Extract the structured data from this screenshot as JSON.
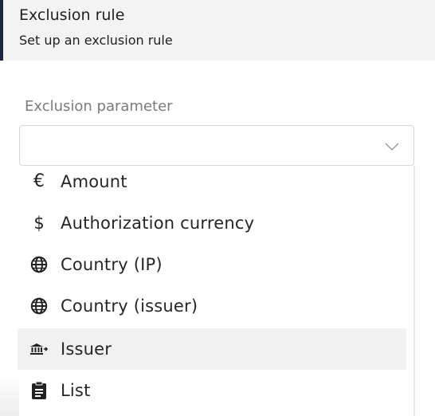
{
  "header": {
    "title": "Exclusion rule",
    "subtitle": "Set up an exclusion rule"
  },
  "field": {
    "label": "Exclusion parameter",
    "value": "",
    "chevron_icon": "chevron-down-icon"
  },
  "options": [
    {
      "label": "Amount",
      "icon": "euro-icon"
    },
    {
      "label": "Authorization currency",
      "icon": "dollar-icon"
    },
    {
      "label": "Country (IP)",
      "icon": "globe-icon"
    },
    {
      "label": "Country (issuer)",
      "icon": "globe-icon"
    },
    {
      "label": "Issuer",
      "icon": "bank-icon",
      "highlighted": true
    },
    {
      "label": "List",
      "icon": "clipboard-icon"
    }
  ],
  "colors": {
    "header_bg": "#f3f3f4",
    "header_accent": "#1d2540",
    "label_gray": "#7b7b7b",
    "hover_bg": "#f1f1f1"
  }
}
